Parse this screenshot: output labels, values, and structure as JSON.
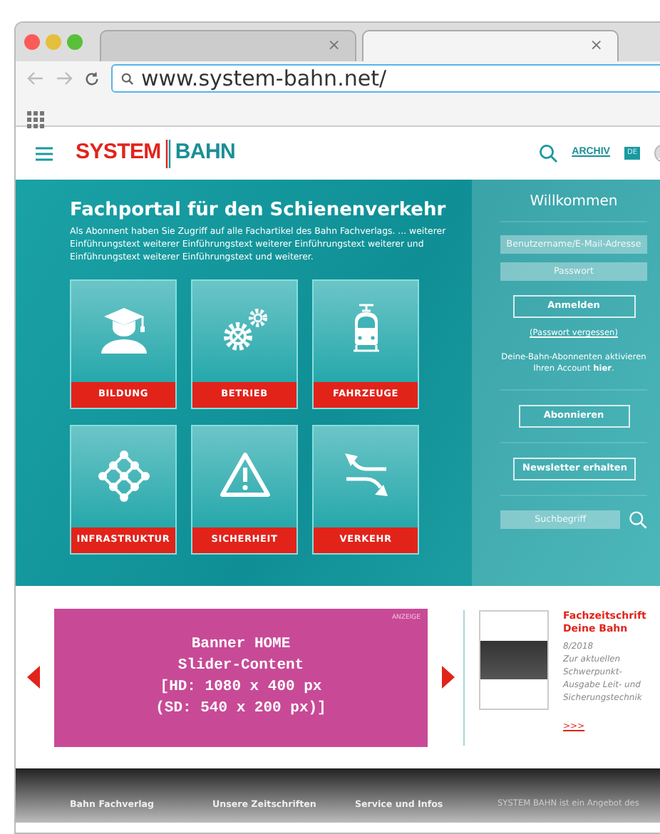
{
  "browser": {
    "tabs": [
      {
        "close": "×",
        "selected": false
      },
      {
        "close": "×",
        "selected": true
      }
    ],
    "url": "www.system-bahn.net/"
  },
  "header": {
    "logo_left": "SYSTEM",
    "logo_right": "BAHN",
    "archive": "ARCHIV",
    "language": "DE"
  },
  "hero": {
    "title": "Fachportal für den Schienenverkehr",
    "intro": "Als Abonnent haben Sie Zugriff auf alle Fachartikel des Bahn Fachverlags.  ... weiterer Einführungstext weiterer Einführungstext weiterer Einführungstext weiterer und Einführungstext weiterer Einführungstext und weiterer.",
    "categories": [
      {
        "label": "BILDUNG",
        "kind": "graduate"
      },
      {
        "label": "BETRIEB",
        "kind": "gears"
      },
      {
        "label": "FAHRZEUGE",
        "kind": "train"
      },
      {
        "label": "INFRASTRUKTUR",
        "kind": "network"
      },
      {
        "label": "SICHERHEIT",
        "kind": "warning"
      },
      {
        "label": "VERKEHR",
        "kind": "arrows"
      }
    ]
  },
  "login": {
    "title": "Willkommen",
    "username_placeholder": "Benutzername/E-Mail-Adresse",
    "password_placeholder": "Passwort",
    "login_button": "Anmelden",
    "forgot_link": "(Passwort vergessen)",
    "activate_text": "Deine-Bahn-Abonnenten aktivieren Ihren Account ",
    "activate_link": "hier",
    "activate_end": ".",
    "subscribe_button": "Abonnieren",
    "newsletter_button": "Newsletter erhalten",
    "search_placeholder": "Suchbegriff"
  },
  "banner": {
    "ad_label": "ANZEIGE",
    "lines": [
      "Banner HOME",
      "Slider-Content",
      "[HD: 1080 x 400 px",
      "(SD: 540 x 200 px)]"
    ]
  },
  "magazine": {
    "title": "Fachzeitschrift Deine Bahn",
    "issue": "8/2018",
    "description": "Zur aktuellen Schwerpunkt-Ausgabe Leit- und Sicherungstechnik",
    "more": ">>>"
  },
  "footer": {
    "columns": [
      "Bahn Fachverlag",
      "Unsere Zeitschriften",
      "Service und Infos",
      "SYSTEM BAHN ist ein Angebot des"
    ]
  }
}
